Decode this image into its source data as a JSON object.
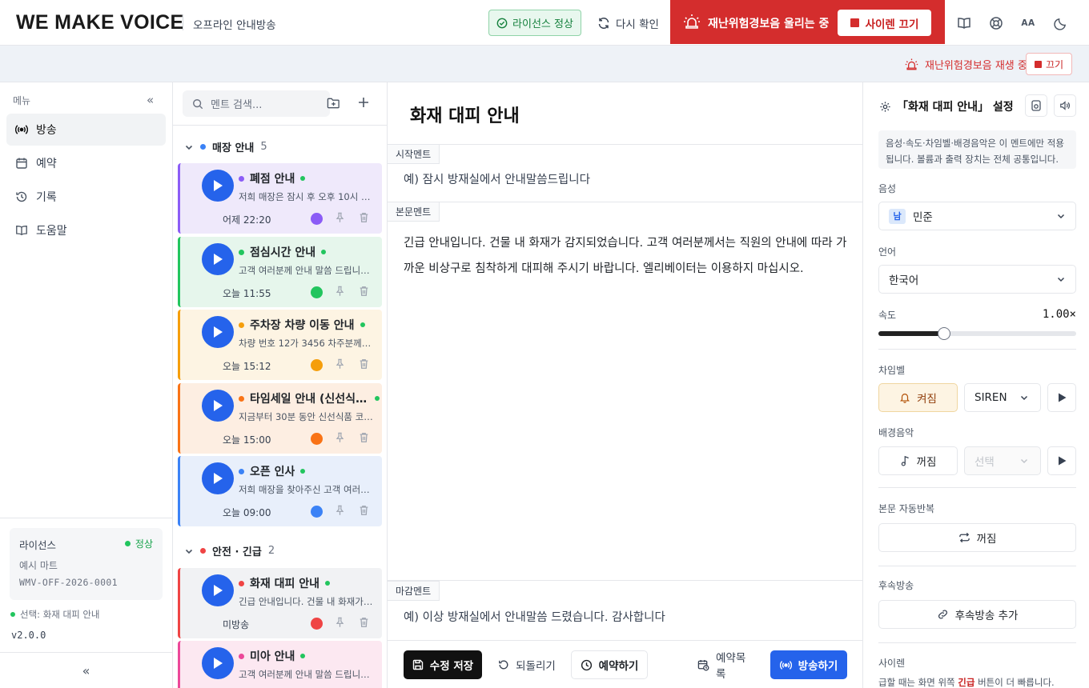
{
  "header": {
    "logo": "WE MAKE VOICE",
    "subtitle": "오프라인 안내방송",
    "license_badge": "라이선스 정상",
    "recheck": "다시 확인",
    "siren_status": "재난위험경보음 울리는 중",
    "siren_stop": "사이렌 끄기",
    "icons": [
      "book-icon",
      "support-icon",
      "font-size-icon",
      "moon-icon"
    ],
    "font_size_label": "AA"
  },
  "notification": {
    "message": "재난위험경보음 재생 중",
    "stop": "끄기"
  },
  "sidebar": {
    "menu_label": "메뉴",
    "collapse": "«",
    "items": [
      {
        "label": "방송",
        "icon": "broadcast-icon",
        "active": true
      },
      {
        "label": "예약",
        "icon": "calendar-icon",
        "active": false
      },
      {
        "label": "기록",
        "icon": "history-icon",
        "active": false
      },
      {
        "label": "도움말",
        "icon": "book-icon",
        "active": false
      }
    ],
    "license": {
      "title": "라이선스",
      "status": "정상",
      "name": "예시 마트",
      "code": "WMV-OFF-2026-0001"
    },
    "selected": "선택: 화재 대피 안내",
    "version": "v2.0.0",
    "bottom_collapse": "«"
  },
  "list": {
    "search_placeholder": "멘트 검색...",
    "groups": [
      {
        "name": "매장 안내",
        "count": "5",
        "color": "#3b82f6"
      },
      {
        "name": "안전 · 긴급",
        "count": "2",
        "color": "#ef4444"
      }
    ],
    "cards": [
      {
        "title": "폐점 안내",
        "desc": "저희 매장은 잠시 후 오후 10시 30분에 영업을 종료합니다.",
        "time": "어제 22:20",
        "color": "#8b5cf6",
        "bg": "#efe9fb",
        "border": "#8b5cf6"
      },
      {
        "title": "점심시간 안내",
        "desc": "고객 여러분께 안내 말씀 드립니다. 점심시간 안내입니다.",
        "time": "오늘 11:55",
        "color": "#22c55e",
        "bg": "#e6f6ec",
        "border": "#22c55e"
      },
      {
        "title": "주차장 차량 이동 안내",
        "desc": "차량 번호 12가 3456 차주분께서는 차량을 이동해 주십시오.",
        "time": "오늘 15:12",
        "color": "#f59e0b",
        "bg": "#fdf4e3",
        "border": "#f59e0b"
      },
      {
        "title": "타임세일 안내 (신선식품)",
        "desc": "지금부터 30분 동안 신선식품 코너에서 타임세일을 진행합니다.",
        "time": "오늘 15:00",
        "color": "#f97316",
        "bg": "#fdeee2",
        "border": "#f97316"
      },
      {
        "title": "오픈 인사",
        "desc": "저희 매장을 찾아주신 고객 여러분 진심으로 감사드립니다.",
        "time": "오늘 09:00",
        "color": "#3b82f6",
        "bg": "#e8effb",
        "border": "#3b82f6"
      },
      {
        "title": "화재 대피 안내",
        "desc": "긴급 안내입니다. 건물 내 화재가 감지되었습니다.",
        "time": "미방송",
        "color": "#ef4444",
        "bg": "#f1f2f4",
        "border": "#ef4444"
      },
      {
        "title": "미아 안내",
        "desc": "고객 여러분께 안내 말씀 드립니다. 미아를 찾습니다.",
        "time": "",
        "color": "#ec4899",
        "bg": "#fce8f1",
        "border": "#ec4899"
      }
    ]
  },
  "editor": {
    "title": "화재 대피 안내",
    "start_label": "시작멘트",
    "start_text": "예) 잠시 방재실에서 안내말씀드립니다",
    "body_label": "본문멘트",
    "body_text": "긴급 안내입니다. 건물 내 화재가 감지되었습니다. 고객 여러분께서는 직원의 안내에 따라 가까운 비상구로 침착하게 대피해 주시기 바랍니다. 엘리베이터는 이용하지 마십시오.",
    "end_label": "마감멘트",
    "end_text": "예) 이상 방재실에서 안내말씀 드렸습니다. 감사합니다",
    "save": "수정 저장",
    "revert": "되돌리기",
    "reserve": "예약하기",
    "reservation_list": "예약목록",
    "broadcast": "방송하기"
  },
  "settings": {
    "title": "「화재 대피 안내」 설정",
    "note": "음성·속도·차임벨·배경음악은 이 멘트에만 적용됩니다. 볼륨과 출력 장치는 전체 공통입니다.",
    "voice_label": "음성",
    "voice_tag": "남",
    "voice": "민준",
    "language_label": "언어",
    "language": "한국어",
    "speed_label": "속도",
    "speed_value": "1.00×",
    "speed_min": 0.5,
    "speed_max": 2.0,
    "speed": 1.0,
    "chime_label": "차임벨",
    "chime_state": "켜짐",
    "chime_sound": "SIREN",
    "bgm_label": "배경음악",
    "bgm_state": "꺼짐",
    "bgm_select": "선택",
    "repeat_label": "본문 자동반복",
    "repeat_state": "꺼짐",
    "follow_label": "후속방송",
    "follow_add": "후속방송 추가",
    "siren_label": "사이렌",
    "siren_note_pre": "급할 때는 화면 위쪽 ",
    "siren_note_bold": "긴급",
    "siren_note_post": " 버튼이 더 빠릅니다."
  }
}
